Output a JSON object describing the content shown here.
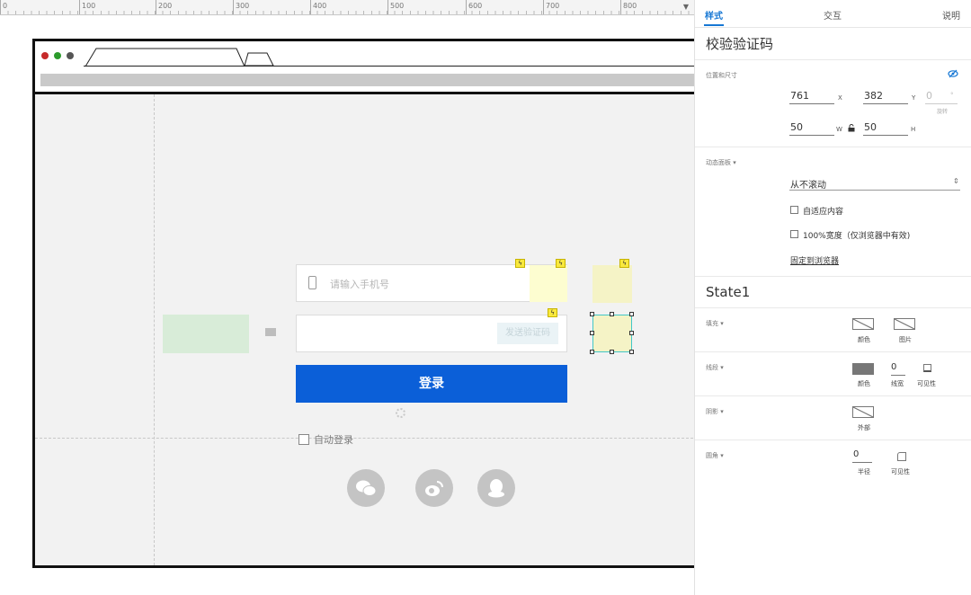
{
  "ruler": {
    "labels": [
      "0",
      "100",
      "200",
      "300",
      "400",
      "500",
      "600",
      "700",
      "800"
    ]
  },
  "icons": {
    "ruler_caret": "chevron-down-icon",
    "phone": "mobile-phone-icon",
    "mail": "envelope-icon",
    "bolt": "lightning-icon",
    "spinner": "loading-spinner-icon",
    "social": [
      "wechat-icon",
      "weibo-icon",
      "qq-icon"
    ],
    "visibility": "eye-slash-icon",
    "lock": "lock-icon",
    "select_arrow": "up-down-arrow-icon"
  },
  "colors": {
    "accent": "#1677d4",
    "login_button": "#0b5fd8",
    "selection": "#43c7c7",
    "interaction_marker": "#f9e93e"
  },
  "mockup": {
    "phone_placeholder": "请输入手机号",
    "send_code_label": "发送验证码",
    "login_label": "登录",
    "auto_login_label": "自动登录"
  },
  "panel": {
    "tabs": [
      "样式",
      "交互",
      "说明"
    ],
    "widget_name": "校验验证码",
    "position_section": "位置和尺寸",
    "x": "761",
    "x_unit": "X",
    "y": "382",
    "y_unit": "Y",
    "rotation": "0",
    "rotation_unit": "°",
    "rotation_caption": "旋转",
    "w": "50",
    "w_unit": "W",
    "h": "50",
    "h_unit": "H",
    "dynamic_panel_section": "动态面板 ▾",
    "scroll_option": "从不滚动",
    "fit_content": "自适应内容",
    "full_width": "100%宽度（仅浏览器中有效)",
    "pin_to_browser": "固定到浏览器",
    "state_name": "State1",
    "fill_section": "填充 ▾",
    "fill_color": "颜色",
    "fill_image": "图片",
    "border_section": "线段 ▾",
    "border_color": "颜色",
    "border_width_value": "0",
    "border_width": "线宽",
    "border_visibility": "可见性",
    "shadow_section": "阴影 ▾",
    "shadow_outer": "外部",
    "radius_section": "圆角 ▾",
    "radius_value": "0",
    "radius_label": "半径",
    "radius_visibility": "可见性"
  }
}
